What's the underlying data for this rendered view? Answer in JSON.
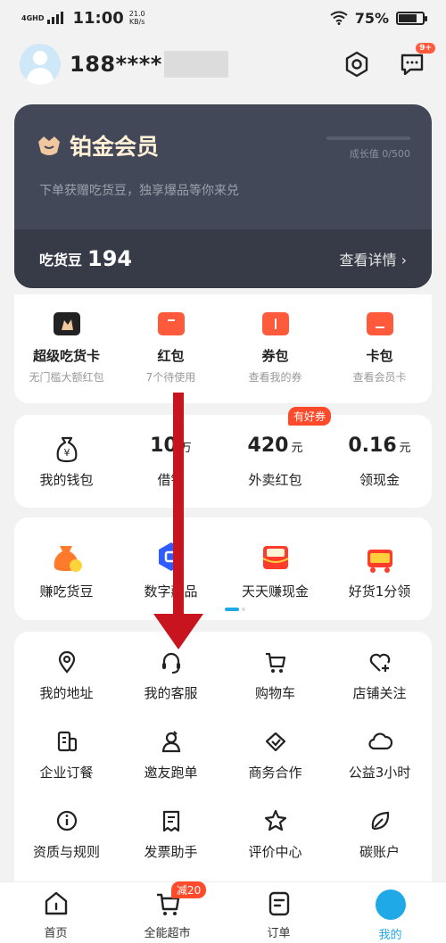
{
  "status_bar": {
    "network": "4GHD",
    "time": "11:00",
    "speed_value": "21.0",
    "speed_unit": "KB/s",
    "battery": "75%",
    "battery_level": 0.75
  },
  "header": {
    "phone": "188****",
    "message_badge": "9+"
  },
  "member": {
    "title": "铂金会员",
    "growth": "成长值 0/500",
    "subtitle": "下单获赠吃货豆，独享爆品等你来兑",
    "beans_label": "吃货豆",
    "beans_value": "194",
    "details_label": "查看详情 ›"
  },
  "wallet_items": [
    {
      "title": "超级吃货卡",
      "sub": "无门槛大额红包"
    },
    {
      "title": "红包",
      "sub": "7个待使用"
    },
    {
      "title": "券包",
      "sub": "查看我的券"
    },
    {
      "title": "卡包",
      "sub": "查看会员卡"
    }
  ],
  "finance": {
    "wallet_label": "我的钱包",
    "borrow_num": "10",
    "borrow_unit": "万",
    "borrow_label": "借钱",
    "redpack_num": "420",
    "redpack_unit": "元",
    "redpack_label": "外卖红包",
    "redpack_badge": "有好券",
    "cash_num": "0.16",
    "cash_unit": "元",
    "cash_label": "领现金"
  },
  "promos": [
    {
      "label": "赚吃货豆"
    },
    {
      "label": "数字藏品"
    },
    {
      "label": "天天赚现金"
    },
    {
      "label": "好货1分领"
    }
  ],
  "services": [
    {
      "label": "我的地址",
      "icon": "location-icon"
    },
    {
      "label": "我的客服",
      "icon": "headset-icon"
    },
    {
      "label": "购物车",
      "icon": "cart-icon"
    },
    {
      "label": "店铺关注",
      "icon": "heart-plus-icon"
    },
    {
      "label": "企业订餐",
      "icon": "building-icon"
    },
    {
      "label": "邀友跑单",
      "icon": "invite-icon"
    },
    {
      "label": "商务合作",
      "icon": "handshake-icon"
    },
    {
      "label": "公益3小时",
      "icon": "cloud-icon"
    },
    {
      "label": "资质与规则",
      "icon": "info-icon"
    },
    {
      "label": "发票助手",
      "icon": "receipt-icon"
    },
    {
      "label": "评价中心",
      "icon": "star-icon"
    },
    {
      "label": "碳账户",
      "icon": "leaf-icon"
    }
  ],
  "tabs": [
    {
      "label": "首页"
    },
    {
      "label": "全能超市",
      "badge": "减20"
    },
    {
      "label": "订单"
    },
    {
      "label": "我的"
    }
  ],
  "colors": {
    "accent": "#1fa9e6",
    "member_bg": "#434858",
    "red": "#ff4b2b",
    "arrow": "#c8141e"
  }
}
